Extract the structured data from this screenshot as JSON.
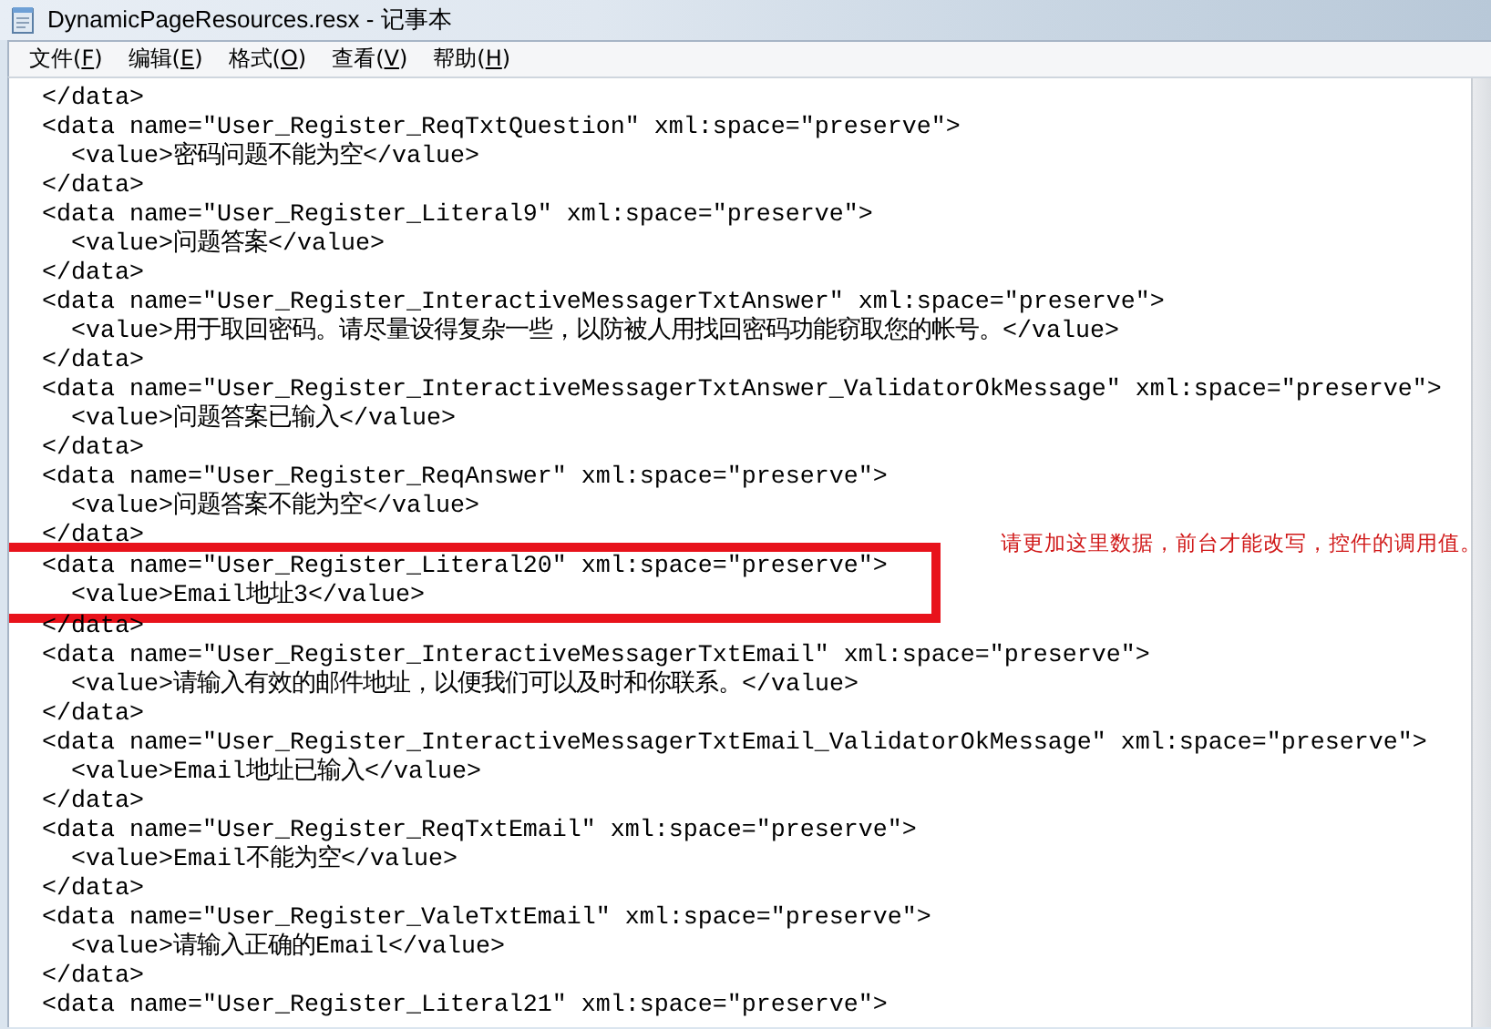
{
  "window": {
    "title": "DynamicPageResources.resx - 记事本"
  },
  "menu": [
    {
      "label": "文件(F)"
    },
    {
      "label": "编辑(E)"
    },
    {
      "label": "格式(O)"
    },
    {
      "label": "查看(V)"
    },
    {
      "label": "帮助(H)"
    }
  ],
  "lines": [
    {
      "text": "  </data>",
      "boxed": false
    },
    {
      "text": "  <data name=\"User_Register_ReqTxtQuestion\" xml:space=\"preserve\">",
      "boxed": false
    },
    {
      "text": "    <value>密码问题不能为空</value>",
      "boxed": false
    },
    {
      "text": "  </data>",
      "boxed": false
    },
    {
      "text": "  <data name=\"User_Register_Literal9\" xml:space=\"preserve\">",
      "boxed": false
    },
    {
      "text": "    <value>问题答案</value>",
      "boxed": false
    },
    {
      "text": "  </data>",
      "boxed": false
    },
    {
      "text": "  <data name=\"User_Register_InteractiveMessagerTxtAnswer\" xml:space=\"preserve\">",
      "boxed": false
    },
    {
      "text": "    <value>用于取回密码。请尽量设得复杂一些，以防被人用找回密码功能窃取您的帐号。</value>",
      "boxed": false
    },
    {
      "text": "  </data>",
      "boxed": false
    },
    {
      "text": "  <data name=\"User_Register_InteractiveMessagerTxtAnswer_ValidatorOkMessage\" xml:space=\"preserve\">",
      "boxed": false
    },
    {
      "text": "    <value>问题答案已输入</value>",
      "boxed": false
    },
    {
      "text": "  </data>",
      "boxed": false
    },
    {
      "text": "  <data name=\"User_Register_ReqAnswer\" xml:space=\"preserve\">",
      "boxed": false
    },
    {
      "text": "    <value>问题答案不能为空</value>",
      "boxed": false
    },
    {
      "text": "  </data>",
      "boxed": false
    },
    {
      "text": "  <data name=\"User_Register_Literal20\" xml:space=\"preserve\">",
      "boxed": true
    },
    {
      "text": "    <value>Email地址3</value>",
      "boxed": true
    },
    {
      "text": "  </data>",
      "boxed": false
    },
    {
      "text": "  <data name=\"User_Register_InteractiveMessagerTxtEmail\" xml:space=\"preserve\">",
      "boxed": false
    },
    {
      "text": "    <value>请输入有效的邮件地址，以便我们可以及时和你联系。</value>",
      "boxed": false
    },
    {
      "text": "  </data>",
      "boxed": false
    },
    {
      "text": "  <data name=\"User_Register_InteractiveMessagerTxtEmail_ValidatorOkMessage\" xml:space=\"preserve\">",
      "boxed": false
    },
    {
      "text": "    <value>Email地址已输入</value>",
      "boxed": false
    },
    {
      "text": "  </data>",
      "boxed": false
    },
    {
      "text": "  <data name=\"User_Register_ReqTxtEmail\" xml:space=\"preserve\">",
      "boxed": false
    },
    {
      "text": "    <value>Email不能为空</value>",
      "boxed": false
    },
    {
      "text": "  </data>",
      "boxed": false
    },
    {
      "text": "  <data name=\"User_Register_ValeTxtEmail\" xml:space=\"preserve\">",
      "boxed": false
    },
    {
      "text": "    <value>请输入正确的Email</value>",
      "boxed": false
    },
    {
      "text": "  </data>",
      "boxed": false
    },
    {
      "text": "  <data name=\"User_Register_Literal21\" xml:space=\"preserve\">",
      "boxed": false
    }
  ],
  "annotation": {
    "note": "请更加这里数据，前台才能改写，控件的调用值。"
  }
}
